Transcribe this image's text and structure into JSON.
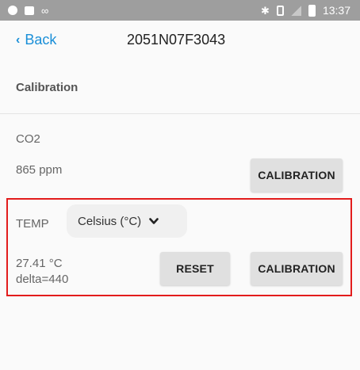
{
  "status_bar": {
    "time": "13:37",
    "left_icons": [
      "notification-dot-icon",
      "image-icon",
      "link-icon"
    ],
    "right_icons": [
      "bluetooth-icon",
      "vibrate-icon",
      "no-signal-icon",
      "battery-icon"
    ]
  },
  "header": {
    "back_label": "Back",
    "title": "2051N07F3043"
  },
  "section": {
    "title": "Calibration"
  },
  "co2": {
    "label": "CO2",
    "value": "865 ppm",
    "calibration_label": "CALIBRATION"
  },
  "temp": {
    "label": "TEMP",
    "unit_selected": "Celsius (°C)",
    "value": "27.41 °C",
    "delta": "delta=440",
    "reset_label": "RESET",
    "calibration_label": "CALIBRATION"
  },
  "colors": {
    "accent": "#1a8fd8",
    "highlight_border": "#e21c1c",
    "status_bar": "#9e9e9e",
    "button_bg": "#e0e0e0"
  }
}
